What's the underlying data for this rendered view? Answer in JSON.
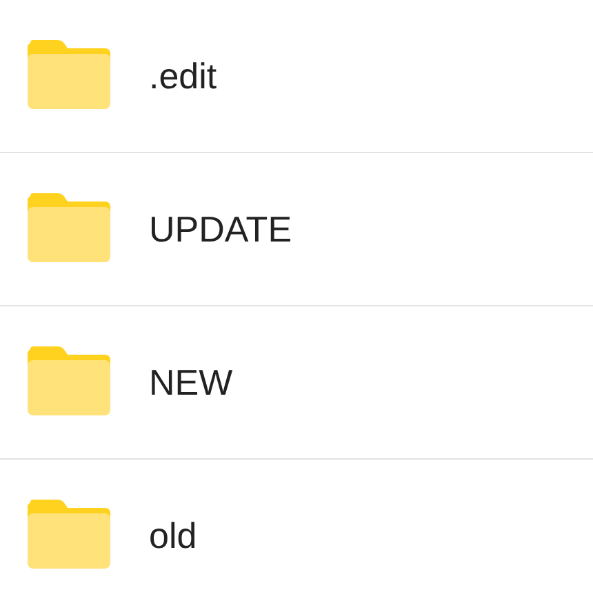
{
  "folders": [
    {
      "name": ".edit"
    },
    {
      "name": "UPDATE"
    },
    {
      "name": "NEW"
    },
    {
      "name": "old"
    }
  ]
}
